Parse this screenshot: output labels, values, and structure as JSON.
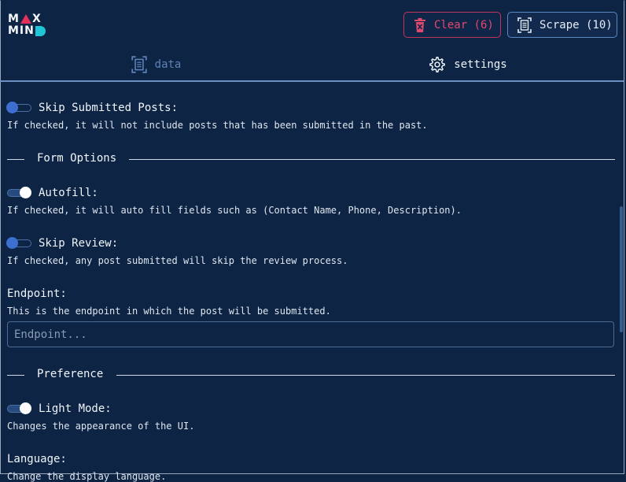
{
  "app": {
    "logo_line1": "MAX",
    "logo_line2": "MIND"
  },
  "header": {
    "clear_label": "Clear (6)",
    "scrape_label": "Scrape (10)",
    "colors": {
      "clear": "#e0496e",
      "scrape_border": "#5a86c2",
      "background": "#0d2444"
    }
  },
  "tabs": [
    {
      "label": "data",
      "active": false
    },
    {
      "label": "settings",
      "active": true
    }
  ],
  "settings": {
    "skip_submitted": {
      "title": "Skip Submitted Posts:",
      "desc": "If checked, it will not include posts that has been submitted in the past.",
      "checked": false
    },
    "form_options_heading": "Form Options",
    "autofill": {
      "title": "Autofill:",
      "desc": "If checked, it will auto fill fields such as (Contact Name, Phone, Description).",
      "checked": true
    },
    "skip_review": {
      "title": "Skip Review:",
      "desc": "If checked, any post submitted will skip the review process.",
      "checked": false
    },
    "endpoint": {
      "title": "Endpoint:",
      "desc": "This is the endpoint in which the post will be submitted.",
      "placeholder": "Endpoint...",
      "value": ""
    },
    "preference_heading": "Preference",
    "light_mode": {
      "title": "Light Mode:",
      "desc": "Changes the appearance of the UI.",
      "checked": true
    },
    "language": {
      "title": "Language:",
      "desc": "Change the display language."
    }
  },
  "icons": {
    "clear": "trash-icon",
    "scrape": "scan-document-icon",
    "data_tab": "scan-document-icon",
    "settings_tab": "gear-icon"
  }
}
